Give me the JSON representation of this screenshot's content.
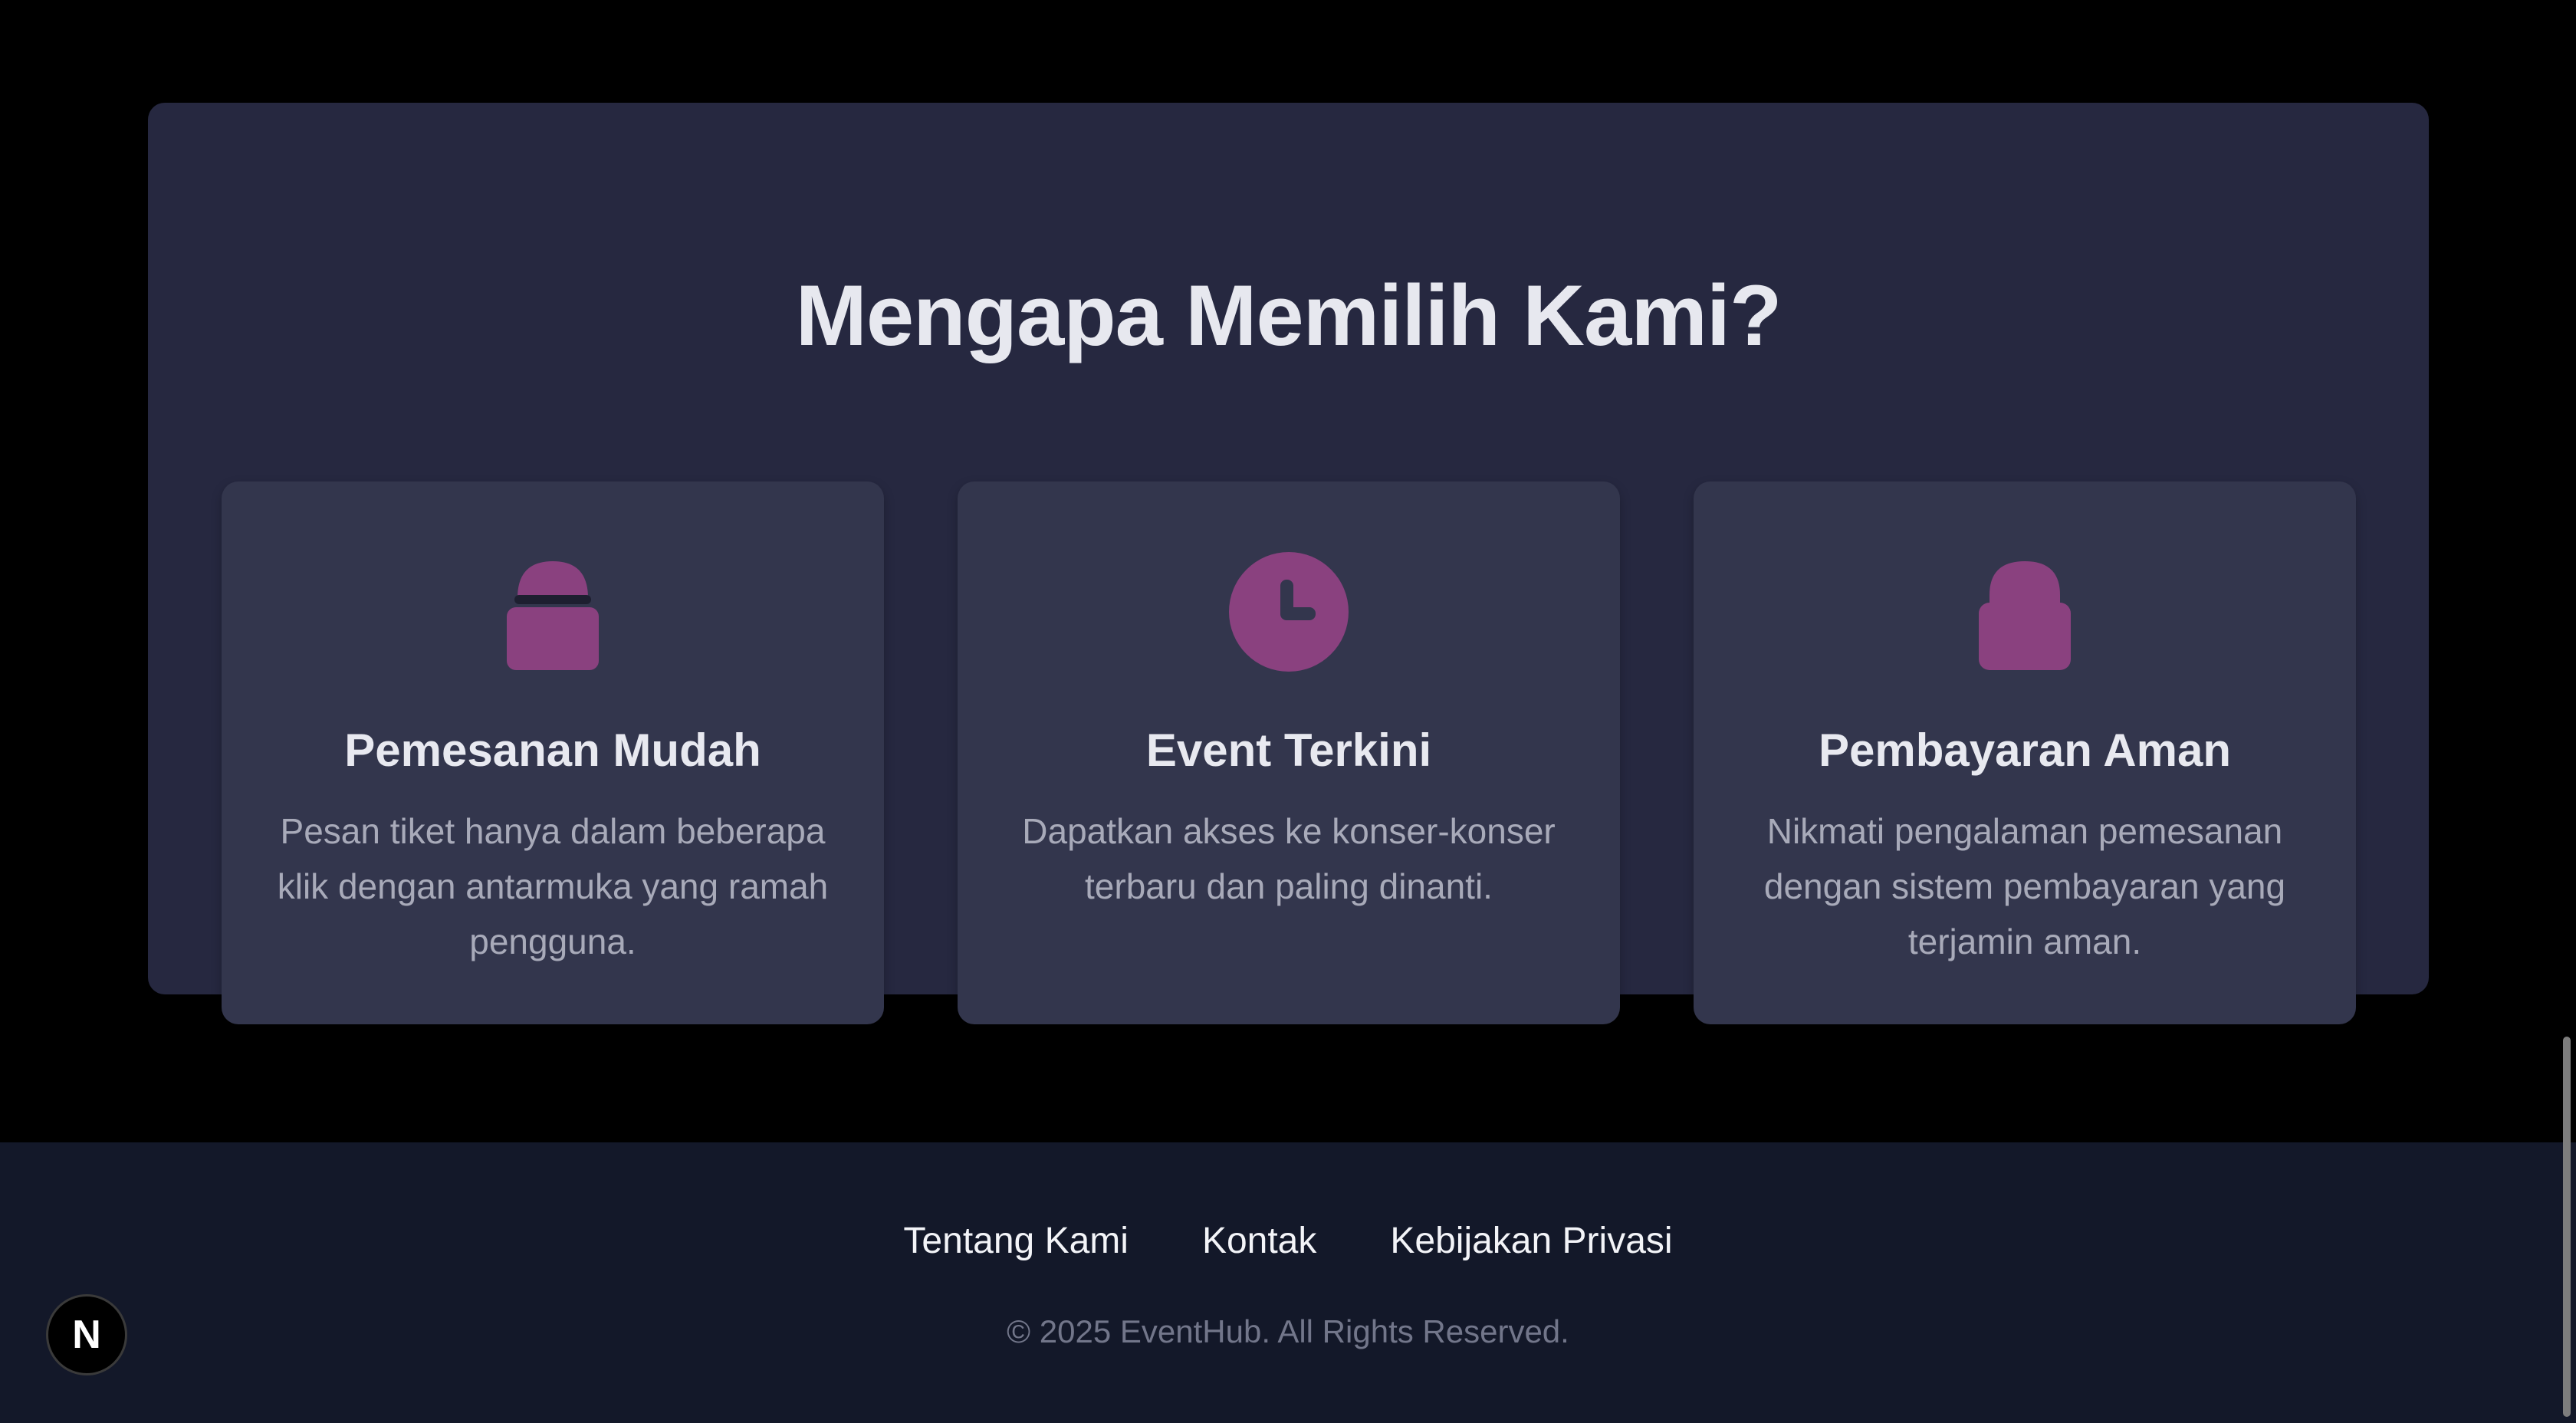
{
  "why_section": {
    "title": "Mengapa Memilih Kami?",
    "features": [
      {
        "icon": "shopping-bag-icon",
        "title": "Pemesanan Mudah",
        "description": "Pesan tiket hanya dalam beberapa klik dengan antarmuka yang ramah pengguna."
      },
      {
        "icon": "clock-icon",
        "title": "Event Terkini",
        "description": "Dapatkan akses ke konser-konser terbaru dan paling dinanti."
      },
      {
        "icon": "lock-icon",
        "title": "Pembayaran Aman",
        "description": "Nikmati pengalaman pemesanan dengan sistem pembayaran yang terjamin aman."
      }
    ]
  },
  "footer": {
    "links": [
      "Tentang Kami",
      "Kontak",
      "Kebijakan Privasi"
    ],
    "copyright": "© 2025 EventHub. All Rights Reserved."
  },
  "next_badge": {
    "label": "N"
  },
  "colors": {
    "accent": "#8a417f",
    "section_bg": "#262840",
    "card_bg": "#33364d",
    "footer_bg": "#131829"
  }
}
